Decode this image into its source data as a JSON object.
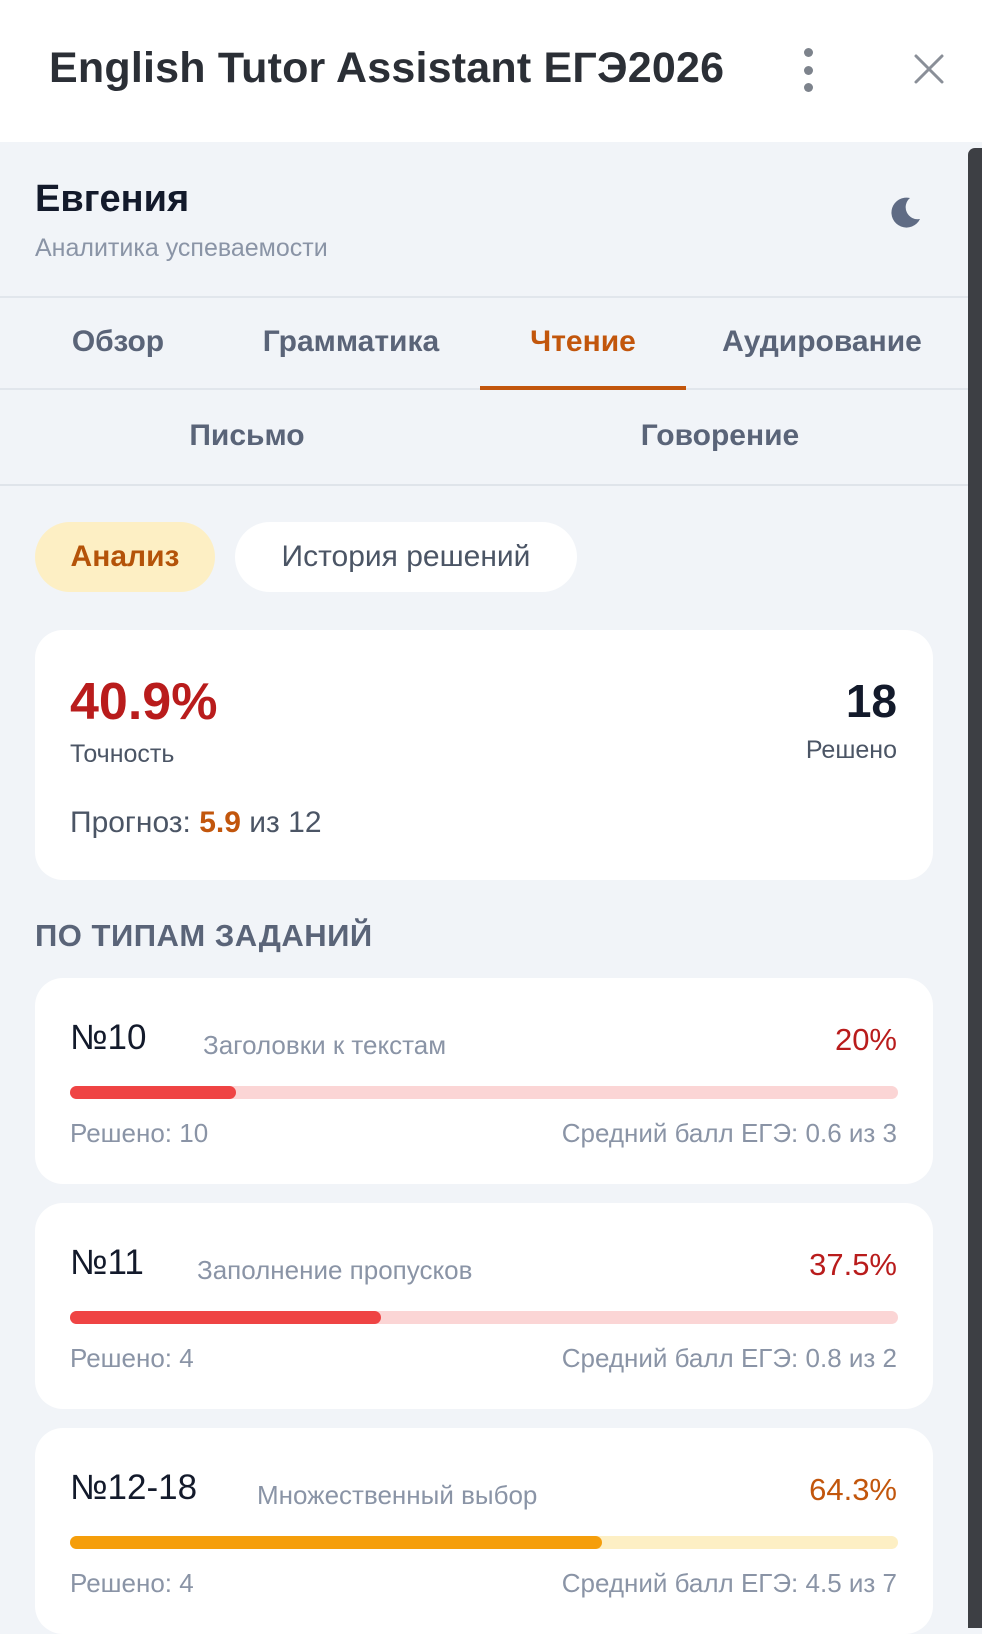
{
  "window": {
    "title": "English Tutor Assistant ЕГЭ2026",
    "menu_icon": "kebab-menu-icon",
    "close_icon": "close-icon"
  },
  "header": {
    "name": "Евгения",
    "subtitle": "Аналитика успеваемости",
    "theme_icon": "moon-icon"
  },
  "tabs": [
    {
      "label": "Обзор",
      "active": false
    },
    {
      "label": "Грамматика",
      "active": false
    },
    {
      "label": "Чтение",
      "active": true
    },
    {
      "label": "Аудирование",
      "active": false
    },
    {
      "label": "Письмо",
      "active": false
    },
    {
      "label": "Говорение",
      "active": false
    }
  ],
  "subtabs": [
    {
      "label": "Анализ",
      "active": true
    },
    {
      "label": "История решений",
      "active": false
    }
  ],
  "summary": {
    "accuracy": "40.9%",
    "accuracy_label": "Точность",
    "solved": "18",
    "solved_label": "Решено",
    "forecast_label": "Прогноз:",
    "forecast_value": "5.9",
    "forecast_suffix": "из 12"
  },
  "section_title": "ПО ТИПАМ ЗАДАНИЙ",
  "tasks": [
    {
      "number": "№10",
      "name": "Заголовки к текстам",
      "percent": "20%",
      "progress": 0.2,
      "solved": "Решено: 10",
      "avg": "Средний балл ЕГЭ: 0.6 из 3",
      "color": "#b91c1c"
    },
    {
      "number": "№11",
      "name": "Заполнение пропусков",
      "percent": "37.5%",
      "progress": 0.375,
      "solved": "Решено: 4",
      "avg": "Средний балл ЕГЭ: 0.8 из 2",
      "color": "#b91c1c"
    },
    {
      "number": "№12-18",
      "name": "Множественный выбор",
      "percent": "64.3%",
      "progress": 0.643,
      "solved": "Решено: 4",
      "avg": "Средний балл ЕГЭ: 4.5 из 7",
      "color": "#c2560c"
    }
  ],
  "colors": {
    "accent": "#c2560c",
    "danger": "#b91c1c",
    "bar_red": "#ef4444",
    "bar_amber": "#f59e0b"
  }
}
